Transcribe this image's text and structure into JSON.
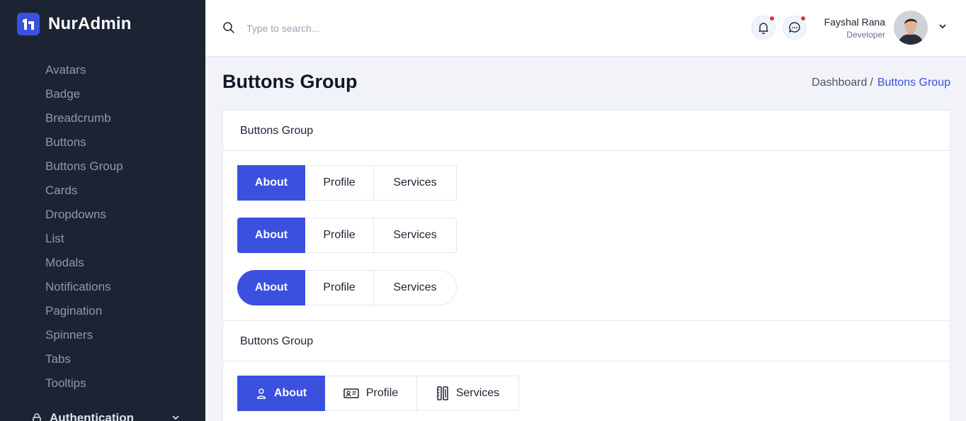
{
  "app": {
    "name": "NurAdmin"
  },
  "sidebar": {
    "items": [
      {
        "label": "Avatars"
      },
      {
        "label": "Badge"
      },
      {
        "label": "Breadcrumb"
      },
      {
        "label": "Buttons"
      },
      {
        "label": "Buttons Group"
      },
      {
        "label": "Cards"
      },
      {
        "label": "Dropdowns"
      },
      {
        "label": "List"
      },
      {
        "label": "Modals"
      },
      {
        "label": "Notifications"
      },
      {
        "label": "Pagination"
      },
      {
        "label": "Spinners"
      },
      {
        "label": "Tabs"
      },
      {
        "label": "Tooltips"
      }
    ],
    "next_section": "Authentication"
  },
  "header": {
    "search_placeholder": "Type to search...",
    "user": {
      "name": "Fayshal Rana",
      "role": "Developer"
    }
  },
  "page": {
    "title": "Buttons Group",
    "breadcrumb": {
      "parent": "Dashboard",
      "separator": "/",
      "current": "Buttons Group"
    }
  },
  "cards": [
    {
      "title": "Buttons Group",
      "groups": [
        {
          "buttons": [
            "About",
            "Profile",
            "Services"
          ]
        },
        {
          "buttons": [
            "About",
            "Profile",
            "Services"
          ]
        },
        {
          "buttons": [
            "About",
            "Profile",
            "Services"
          ]
        }
      ]
    },
    {
      "title": "Buttons Group",
      "groups": [
        {
          "buttons": [
            {
              "label": "About",
              "icon": "user-icon"
            },
            {
              "label": "Profile",
              "icon": "id-card-icon"
            },
            {
              "label": "Services",
              "icon": "tools-icon"
            }
          ]
        }
      ]
    }
  ],
  "colors": {
    "primary": "#3c50e0",
    "sidebar_bg": "#1c2434",
    "notification_dot": "#dc3545"
  }
}
